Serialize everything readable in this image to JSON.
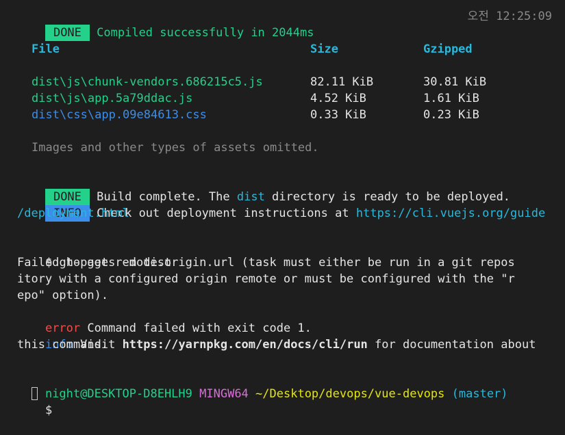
{
  "compile": {
    "badge": "DONE",
    "message": "Compiled successfully in 2044ms",
    "time": "오전 12:25:09"
  },
  "assets": {
    "headers": [
      "File",
      "Size",
      "Gzipped"
    ],
    "rows": [
      {
        "file": "dist\\js\\chunk-vendors.686215c5.js",
        "size": "82.11 KiB",
        "gzipped": "30.81 KiB"
      },
      {
        "file": "dist\\js\\app.5a79ddac.js",
        "size": "4.52 KiB",
        "gzipped": "1.61 KiB"
      },
      {
        "file": "dist\\css\\app.09e84613.css",
        "size": "0.33 KiB",
        "gzipped": "0.23 KiB"
      }
    ],
    "note": "Images and other types of assets omitted."
  },
  "build": {
    "badge": "DONE",
    "msg_part1": "Build complete. The ",
    "dir": "dist",
    "msg_part2": " directory is ready to be deployed."
  },
  "deploy_info": {
    "badge": "INFO",
    "msg": "Check out deployment instructions at ",
    "url_line1": "https://cli.vuejs.org/guide",
    "url_line2": "/deployment.html"
  },
  "command": {
    "prompt": "$",
    "text": "gh-pages -d dist"
  },
  "error_output": {
    "line1": "Failed to get remote.origin.url (task must either be run in a git repos",
    "line2": "itory with a configured origin remote or must be configured with the \"r",
    "line3": "epo\" option).",
    "error_label": "error",
    "error_msg": " Command failed with exit code 1.",
    "info_label": "info",
    "info_msg1": " Visit ",
    "info_url": "https://yarnpkg.com/en/docs/cli/run",
    "info_msg2": " for documentation about",
    "info_msg3": "this command."
  },
  "prompt_line": {
    "user_host": "night@DESKTOP-D8EHLH9",
    "env": "MINGW64",
    "path": "~/Desktop/devops/vue-devops",
    "branch": "(master)",
    "prompt": "$"
  }
}
